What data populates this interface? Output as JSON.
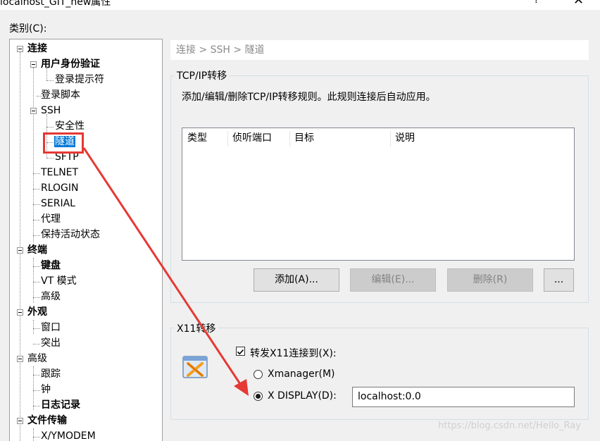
{
  "window": {
    "title": "localhost_GIT_new属性",
    "help": "?",
    "close": "✕"
  },
  "category_label": "类别(C):",
  "tree": {
    "connection": "连接",
    "user_auth": "用户身份验证",
    "login_prompt": "登录提示符",
    "login_script": "登录脚本",
    "ssh": "SSH",
    "security": "安全性",
    "tunnel": "隧道",
    "sftp": "SFTP",
    "telnet": "TELNET",
    "rlogin": "RLOGIN",
    "serial": "SERIAL",
    "proxy": "代理",
    "keepalive": "保持活动状态",
    "terminal": "终端",
    "keyboard": "键盘",
    "vt_mode": "VT 模式",
    "terminal_advanced": "高级",
    "appearance": "外观",
    "window": "窗口",
    "highlight": "突出",
    "advanced": "高级",
    "trace": "跟踪",
    "bell": "钟",
    "logging": "日志记录",
    "file_transfer": "文件传输",
    "xymodem": "X/YMODEM"
  },
  "breadcrumb": "连接 > SSH > 隧道",
  "tcpip": {
    "title": "TCP/IP转移",
    "description": "添加/编辑/删除TCP/IP转移规则。此规则连接后自动应用。",
    "columns": {
      "type": "类型",
      "listen_port": "侦听端口",
      "target": "目标",
      "description": "说明"
    },
    "add_button": "添加(A)...",
    "edit_button": "编辑(E)...",
    "delete_button": "删除(R)",
    "more_button": "..."
  },
  "x11": {
    "title": "X11转移",
    "forward_checkbox": "转发X11连接到(X):",
    "forward_checked": true,
    "xmanager_option": "Xmanager(M)",
    "xdisplay_option": "X DISPLAY(D):",
    "selected_option": "xdisplay",
    "display_value": "localhost:0.0"
  },
  "watermark": "https://blog.csdn.net/Hello_Ray",
  "colors": {
    "selection": "#0078d7",
    "annotation_red": "#e53935"
  }
}
